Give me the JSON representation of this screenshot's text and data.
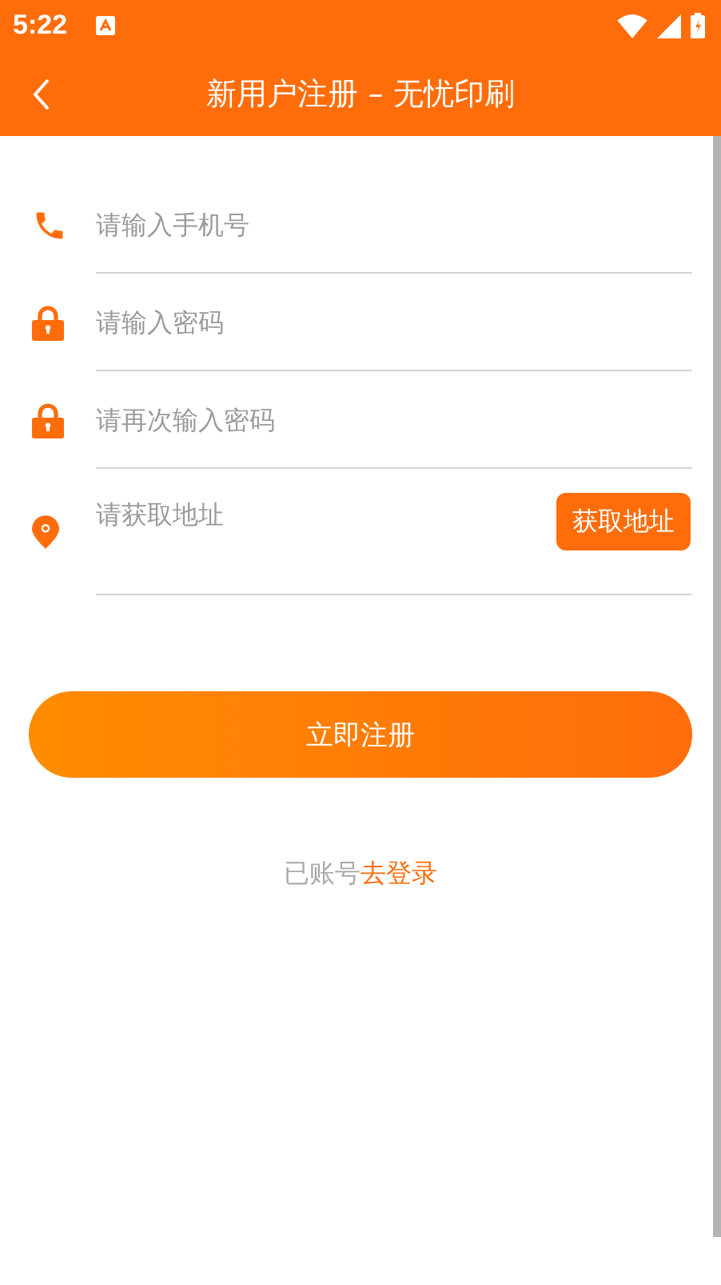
{
  "status_bar": {
    "time": "5:22"
  },
  "app_bar": {
    "title": "新用户注册 – 无忧印刷"
  },
  "fields": [
    {
      "kind": "phone",
      "placeholder": "请输入手机号"
    },
    {
      "kind": "lock",
      "placeholder": "请输入密码"
    },
    {
      "kind": "lock",
      "placeholder": "请再次输入密码"
    },
    {
      "kind": "location",
      "placeholder": "请获取地址",
      "button": "获取地址"
    }
  ],
  "register_button": "立即注册",
  "login_prompt": {
    "text": "已账号",
    "link": "去登录"
  }
}
